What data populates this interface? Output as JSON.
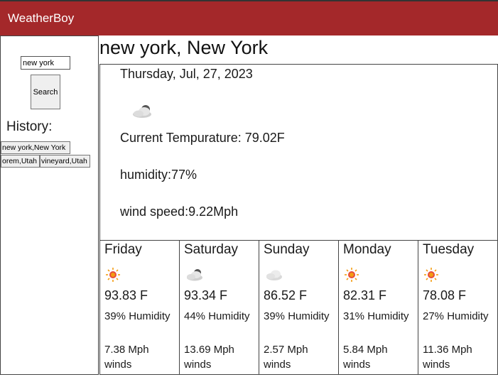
{
  "app": {
    "title": "WeatherBoy"
  },
  "colors": {
    "header_bg": "#a4282a",
    "sun": "#f39c12",
    "cloud": "#bdbdbd"
  },
  "sidebar": {
    "search_value": "new york",
    "search_button": "Search",
    "history_title": "History:",
    "history": [
      "new york,New York",
      "orem,Utah",
      "vineyard,Utah"
    ]
  },
  "current": {
    "city": "new york, New York",
    "date": "Thursday, Jul, 27, 2023",
    "icon": "partly-cloudy-icon",
    "temperature": "Current Tempurature: 79.02F",
    "humidity": "humidity:77%",
    "wind": "wind speed:9.22Mph"
  },
  "forecast": [
    {
      "day": "Friday",
      "icon": "sun-icon",
      "temp": "93.83 F",
      "humidity": "39% Humidity",
      "wind": "7.38 Mph winds"
    },
    {
      "day": "Saturday",
      "icon": "partly-cloudy-icon",
      "temp": "93.34 F",
      "humidity": "44% Humidity",
      "wind": "13.69 Mph winds"
    },
    {
      "day": "Sunday",
      "icon": "cloud-icon",
      "temp": "86.52 F",
      "humidity": "39% Humidity",
      "wind": "2.57 Mph winds"
    },
    {
      "day": "Monday",
      "icon": "sun-icon",
      "temp": "82.31 F",
      "humidity": "31% Humidity",
      "wind": "5.84 Mph winds"
    },
    {
      "day": "Tuesday",
      "icon": "sun-icon",
      "temp": "78.08 F",
      "humidity": "27% Humidity",
      "wind": "11.36 Mph winds"
    }
  ]
}
